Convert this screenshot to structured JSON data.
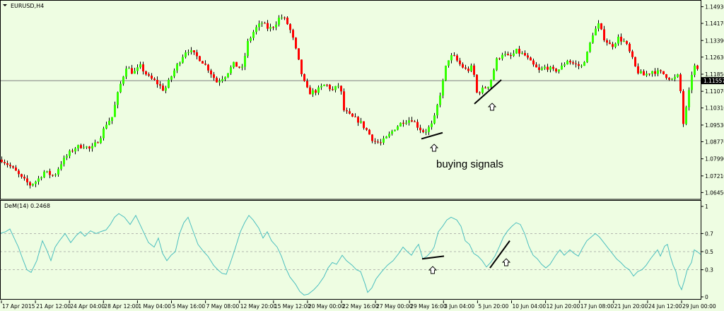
{
  "colors": {
    "background": "#eefde2",
    "bull": "#33ff00",
    "bear": "#ff0000",
    "wick": "#000000",
    "indicator": "#4bbfbf",
    "price_line": "#808080",
    "marker_bg": "#000000",
    "marker_text": "#ffffff"
  },
  "chart_data": [
    {
      "type": "candlestick",
      "title": "EURUSD,H4",
      "symbol": "EURUSD",
      "timeframe": "H4",
      "current_price": 1.11557,
      "current_price_label": "1.11557",
      "ylim": [
        1.0614,
        1.1514
      ],
      "y_ticks": [
        "1.14930",
        "1.14170",
        "1.13390",
        "1.12630",
        "1.11850",
        "1.11070",
        "1.10310",
        "1.09530",
        "1.08770",
        "1.07990",
        "1.07210",
        "1.06450"
      ],
      "y_tick_values": [
        1.1493,
        1.1417,
        1.1339,
        1.1263,
        1.1185,
        1.1107,
        1.1031,
        1.0953,
        1.0877,
        1.0799,
        1.0721,
        1.0645
      ],
      "x_ticks": [
        "17 Apr 2015",
        "21 Apr 12:00",
        "24 Apr 04:00",
        "28 Apr 12:00",
        "1 May 04:00",
        "5 May 16:00",
        "7 May 08:00",
        "12 May 20:00",
        "15 May 12:00",
        "20 May 00:00",
        "22 May 16:00",
        "27 May 00:00",
        "29 May 16:00",
        "3 Jun 04:00",
        "5 Jun 20:00",
        "10 Jun 04:00",
        "12 Jun 20:00",
        "17 Jun 08:00",
        "21 Jun 20:00",
        "24 Jun 12:00",
        "29 Jun 00:00"
      ],
      "close_path": [
        [
          0,
          1.08
        ],
        [
          12,
          1.077
        ],
        [
          22,
          1.074
        ],
        [
          30,
          1.071
        ],
        [
          42,
          1.068
        ],
        [
          52,
          1.07
        ],
        [
          62,
          1.074
        ],
        [
          76,
          1.072
        ],
        [
          86,
          1.078
        ],
        [
          96,
          1.082
        ],
        [
          106,
          1.085
        ],
        [
          118,
          1.086
        ],
        [
          128,
          1.084
        ],
        [
          140,
          1.089
        ],
        [
          150,
          1.096
        ],
        [
          158,
          1.099
        ],
        [
          168,
          1.112
        ],
        [
          178,
          1.122
        ],
        [
          188,
          1.119
        ],
        [
          198,
          1.122
        ],
        [
          210,
          1.117
        ],
        [
          220,
          1.115
        ],
        [
          232,
          1.111
        ],
        [
          244,
          1.119
        ],
        [
          256,
          1.126
        ],
        [
          264,
          1.13
        ],
        [
          272,
          1.128
        ],
        [
          284,
          1.125
        ],
        [
          294,
          1.121
        ],
        [
          306,
          1.115
        ],
        [
          318,
          1.118
        ],
        [
          330,
          1.123
        ],
        [
          342,
          1.121
        ],
        [
          350,
          1.133
        ],
        [
          360,
          1.139
        ],
        [
          370,
          1.142
        ],
        [
          380,
          1.139
        ],
        [
          388,
          1.141
        ],
        [
          396,
          1.145
        ],
        [
          404,
          1.143
        ],
        [
          412,
          1.137
        ],
        [
          420,
          1.127
        ],
        [
          428,
          1.116
        ],
        [
          436,
          1.11
        ],
        [
          448,
          1.111
        ],
        [
          460,
          1.114
        ],
        [
          470,
          1.111
        ],
        [
          480,
          1.114
        ],
        [
          486,
          1.102
        ],
        [
          496,
          1.099
        ],
        [
          508,
          1.097
        ],
        [
          518,
          1.093
        ],
        [
          528,
          1.088
        ],
        [
          538,
          1.087
        ],
        [
          548,
          1.09
        ],
        [
          558,
          1.094
        ],
        [
          570,
          1.097
        ],
        [
          582,
          1.098
        ],
        [
          592,
          1.094
        ],
        [
          600,
          1.092
        ],
        [
          612,
          1.096
        ],
        [
          618,
          1.104
        ],
        [
          626,
          1.115
        ],
        [
          632,
          1.125
        ],
        [
          640,
          1.127
        ],
        [
          650,
          1.123
        ],
        [
          660,
          1.12
        ],
        [
          668,
          1.122
        ],
        [
          674,
          1.11
        ],
        [
          684,
          1.112
        ],
        [
          692,
          1.114
        ],
        [
          702,
          1.125
        ],
        [
          710,
          1.128
        ],
        [
          720,
          1.126
        ],
        [
          730,
          1.129
        ],
        [
          742,
          1.127
        ],
        [
          752,
          1.123
        ],
        [
          762,
          1.12
        ],
        [
          772,
          1.122
        ],
        [
          782,
          1.12
        ],
        [
          792,
          1.121
        ],
        [
          802,
          1.125
        ],
        [
          812,
          1.123
        ],
        [
          822,
          1.122
        ],
        [
          830,
          1.128
        ],
        [
          838,
          1.137
        ],
        [
          846,
          1.141
        ],
        [
          854,
          1.135
        ],
        [
          864,
          1.131
        ],
        [
          874,
          1.135
        ],
        [
          884,
          1.133
        ],
        [
          892,
          1.127
        ],
        [
          900,
          1.12
        ],
        [
          910,
          1.118
        ],
        [
          922,
          1.12
        ],
        [
          936,
          1.119
        ],
        [
          950,
          1.116
        ],
        [
          960,
          1.118
        ],
        [
          966,
          1.096
        ],
        [
          972,
          1.106
        ],
        [
          980,
          1.123
        ],
        [
          986,
          1.12
        ],
        [
          991,
          1.118
        ]
      ],
      "annotations": [
        "buying signals"
      ]
    },
    {
      "type": "line",
      "title": "DeM(14) 0.2468",
      "name": "DeM(14)",
      "value_label": "0.2468",
      "ylim": [
        0,
        1
      ],
      "y_ticks": [
        "1",
        "0.7",
        "0.5",
        "0.3",
        "0"
      ],
      "y_tick_values": [
        1,
        0.7,
        0.5,
        0.3,
        0
      ],
      "levels": [
        0.7,
        0.5,
        0.3
      ],
      "points": [
        [
          0,
          0.7
        ],
        [
          8,
          0.72
        ],
        [
          14,
          0.75
        ],
        [
          20,
          0.65
        ],
        [
          26,
          0.55
        ],
        [
          32,
          0.42
        ],
        [
          38,
          0.3
        ],
        [
          44,
          0.27
        ],
        [
          52,
          0.4
        ],
        [
          60,
          0.62
        ],
        [
          66,
          0.52
        ],
        [
          72,
          0.4
        ],
        [
          78,
          0.55
        ],
        [
          84,
          0.62
        ],
        [
          92,
          0.7
        ],
        [
          100,
          0.6
        ],
        [
          108,
          0.68
        ],
        [
          114,
          0.72
        ],
        [
          120,
          0.67
        ],
        [
          128,
          0.73
        ],
        [
          136,
          0.7
        ],
        [
          142,
          0.72
        ],
        [
          150,
          0.74
        ],
        [
          156,
          0.8
        ],
        [
          162,
          0.88
        ],
        [
          168,
          0.92
        ],
        [
          176,
          0.88
        ],
        [
          184,
          0.8
        ],
        [
          192,
          0.9
        ],
        [
          198,
          0.8
        ],
        [
          204,
          0.7
        ],
        [
          210,
          0.6
        ],
        [
          218,
          0.55
        ],
        [
          224,
          0.65
        ],
        [
          230,
          0.48
        ],
        [
          236,
          0.4
        ],
        [
          242,
          0.46
        ],
        [
          248,
          0.5
        ],
        [
          254,
          0.7
        ],
        [
          260,
          0.82
        ],
        [
          266,
          0.88
        ],
        [
          272,
          0.75
        ],
        [
          280,
          0.58
        ],
        [
          288,
          0.5
        ],
        [
          294,
          0.45
        ],
        [
          302,
          0.35
        ],
        [
          308,
          0.3
        ],
        [
          314,
          0.26
        ],
        [
          320,
          0.25
        ],
        [
          326,
          0.38
        ],
        [
          332,
          0.52
        ],
        [
          340,
          0.72
        ],
        [
          346,
          0.82
        ],
        [
          352,
          0.9
        ],
        [
          358,
          0.85
        ],
        [
          366,
          0.76
        ],
        [
          372,
          0.65
        ],
        [
          378,
          0.72
        ],
        [
          384,
          0.62
        ],
        [
          392,
          0.55
        ],
        [
          398,
          0.45
        ],
        [
          404,
          0.32
        ],
        [
          410,
          0.22
        ],
        [
          418,
          0.14
        ],
        [
          424,
          0.06
        ],
        [
          430,
          0.02
        ],
        [
          436,
          0.03
        ],
        [
          444,
          0.08
        ],
        [
          450,
          0.13
        ],
        [
          458,
          0.22
        ],
        [
          464,
          0.32
        ],
        [
          470,
          0.38
        ],
        [
          476,
          0.36
        ],
        [
          484,
          0.46
        ],
        [
          490,
          0.4
        ],
        [
          498,
          0.35
        ],
        [
          504,
          0.3
        ],
        [
          510,
          0.28
        ],
        [
          516,
          0.15
        ],
        [
          520,
          0.05
        ],
        [
          526,
          0.1
        ],
        [
          532,
          0.2
        ],
        [
          540,
          0.28
        ],
        [
          548,
          0.35
        ],
        [
          556,
          0.4
        ],
        [
          564,
          0.48
        ],
        [
          570,
          0.55
        ],
        [
          576,
          0.5
        ],
        [
          582,
          0.46
        ],
        [
          588,
          0.54
        ],
        [
          592,
          0.58
        ],
        [
          598,
          0.42
        ],
        [
          604,
          0.45
        ],
        [
          610,
          0.5
        ],
        [
          614,
          0.55
        ],
        [
          620,
          0.72
        ],
        [
          626,
          0.78
        ],
        [
          632,
          0.85
        ],
        [
          638,
          0.88
        ],
        [
          646,
          0.85
        ],
        [
          652,
          0.78
        ],
        [
          658,
          0.62
        ],
        [
          664,
          0.58
        ],
        [
          670,
          0.48
        ],
        [
          676,
          0.45
        ],
        [
          682,
          0.4
        ],
        [
          688,
          0.33
        ],
        [
          694,
          0.38
        ],
        [
          700,
          0.45
        ],
        [
          706,
          0.55
        ],
        [
          712,
          0.66
        ],
        [
          718,
          0.73
        ],
        [
          724,
          0.78
        ],
        [
          730,
          0.82
        ],
        [
          736,
          0.8
        ],
        [
          742,
          0.7
        ],
        [
          748,
          0.56
        ],
        [
          754,
          0.46
        ],
        [
          760,
          0.42
        ],
        [
          766,
          0.36
        ],
        [
          772,
          0.32
        ],
        [
          778,
          0.36
        ],
        [
          786,
          0.46
        ],
        [
          792,
          0.52
        ],
        [
          798,
          0.46
        ],
        [
          806,
          0.52
        ],
        [
          812,
          0.48
        ],
        [
          818,
          0.45
        ],
        [
          824,
          0.54
        ],
        [
          830,
          0.62
        ],
        [
          836,
          0.66
        ],
        [
          842,
          0.7
        ],
        [
          848,
          0.66
        ],
        [
          854,
          0.6
        ],
        [
          860,
          0.54
        ],
        [
          866,
          0.48
        ],
        [
          872,
          0.42
        ],
        [
          878,
          0.38
        ],
        [
          884,
          0.33
        ],
        [
          890,
          0.3
        ],
        [
          896,
          0.23
        ],
        [
          902,
          0.28
        ],
        [
          908,
          0.3
        ],
        [
          914,
          0.35
        ],
        [
          920,
          0.42
        ],
        [
          926,
          0.48
        ],
        [
          930,
          0.52
        ],
        [
          934,
          0.45
        ],
        [
          940,
          0.56
        ],
        [
          944,
          0.58
        ],
        [
          948,
          0.45
        ],
        [
          952,
          0.35
        ],
        [
          956,
          0.28
        ],
        [
          960,
          0.14
        ],
        [
          964,
          0.08
        ],
        [
          968,
          0.18
        ],
        [
          972,
          0.3
        ],
        [
          978,
          0.38
        ],
        [
          982,
          0.52
        ],
        [
          986,
          0.5
        ],
        [
          991,
          0.47
        ]
      ],
      "annotations": []
    }
  ]
}
